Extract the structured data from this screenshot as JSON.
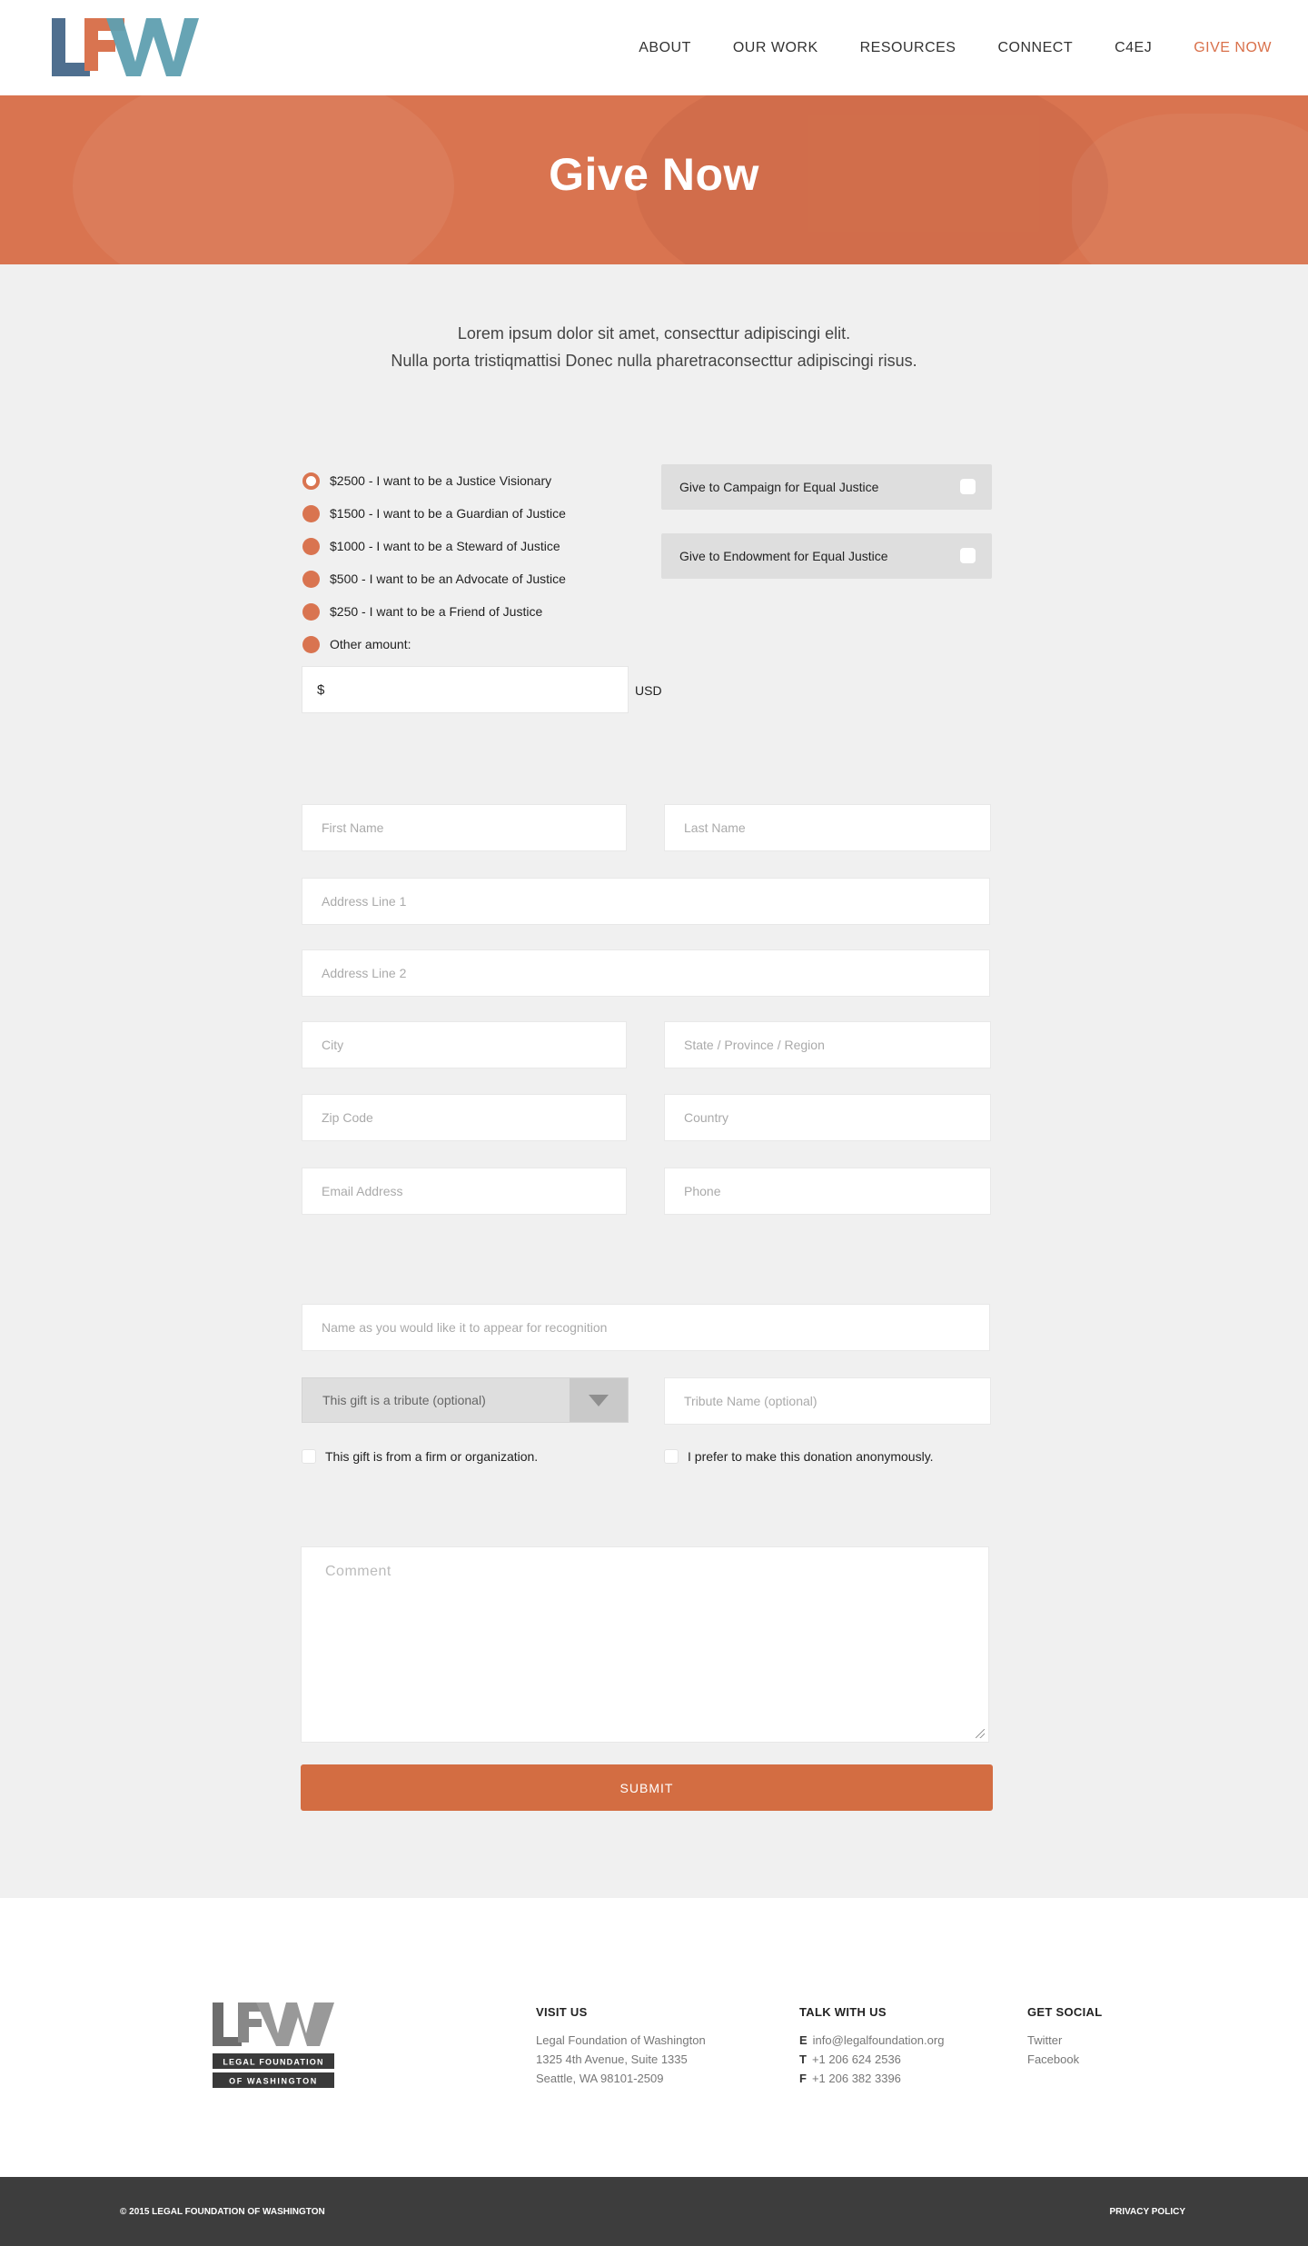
{
  "header": {
    "logo_text": "LFW",
    "nav": [
      {
        "label": "ABOUT",
        "active": false
      },
      {
        "label": "OUR WORK",
        "active": false
      },
      {
        "label": "RESOURCES",
        "active": false
      },
      {
        "label": "CONNECT",
        "active": false
      },
      {
        "label": "C4EJ",
        "active": false
      },
      {
        "label": "GIVE NOW",
        "active": true
      }
    ],
    "accent_color": "#d9704a"
  },
  "hero": {
    "title": "Give Now",
    "background_color": "#d97450"
  },
  "intro": {
    "line1": "Lorem ipsum dolor sit amet, consecttur adipiscingi elit.",
    "line2": "Nulla porta tristiqmattisi Donec nulla pharetraconsecttur adipiscingi risus."
  },
  "donation": {
    "options": [
      {
        "label": "$2500 - I want to be a Justice Visionary",
        "selected": true
      },
      {
        "label": "$1500 - I want to be a Guardian of Justice",
        "selected": false
      },
      {
        "label": "$1000 - I want to be a Steward of Justice",
        "selected": false
      },
      {
        "label": "$500 - I want to be an Advocate of Justice",
        "selected": false
      },
      {
        "label": "$250 - I want to be a Friend of Justice",
        "selected": false
      },
      {
        "label": "Other amount:",
        "selected": false
      }
    ],
    "other_amount_prefix": "$",
    "currency": "USD",
    "funds": [
      {
        "label": "Give to Campaign for Equal Justice",
        "checked": false
      },
      {
        "label": "Give to Endowment for Equal Justice",
        "checked": false
      }
    ]
  },
  "form": {
    "first_name": "First Name",
    "last_name": "Last Name",
    "address1": "Address Line 1",
    "address2": "Address Line 2",
    "city": "City",
    "state": "State / Province / Region",
    "zip": "Zip Code",
    "country": "Country",
    "email": "Email Address",
    "phone": "Phone",
    "recognition_name": "Name as you would like it to appear for recognition",
    "tribute_select": "This gift is a tribute (optional)",
    "tribute_name": "Tribute Name (optional)",
    "firm_checkbox": "This gift is from a firm or organization.",
    "anonymous_checkbox": "I prefer to make this donation anonymously.",
    "comment": "Comment",
    "submit": "SUBMIT"
  },
  "footer": {
    "logo_text": "LFW",
    "logo_line1": "LEGAL FOUNDATION",
    "logo_line2": "OF WASHINGTON",
    "visit": {
      "heading": "VISIT US",
      "lines": [
        "Legal Foundation of Washington",
        "1325 4th Avenue, Suite 1335",
        "Seattle, WA  98101-2509"
      ]
    },
    "talk": {
      "heading": "TALK WITH US",
      "email_label": "E",
      "email": "info@legalfoundation.org",
      "tel_label": "T",
      "tel": "+1 206 624 2536",
      "fax_label": "F",
      "fax": "+1 206 382 3396"
    },
    "social": {
      "heading": "GET SOCIAL",
      "links": [
        "Twitter",
        "Facebook"
      ]
    },
    "copyright": "© 2015 LEGAL FOUNDATION OF WASHINGTON",
    "privacy": "PRIVACY POLICY"
  }
}
